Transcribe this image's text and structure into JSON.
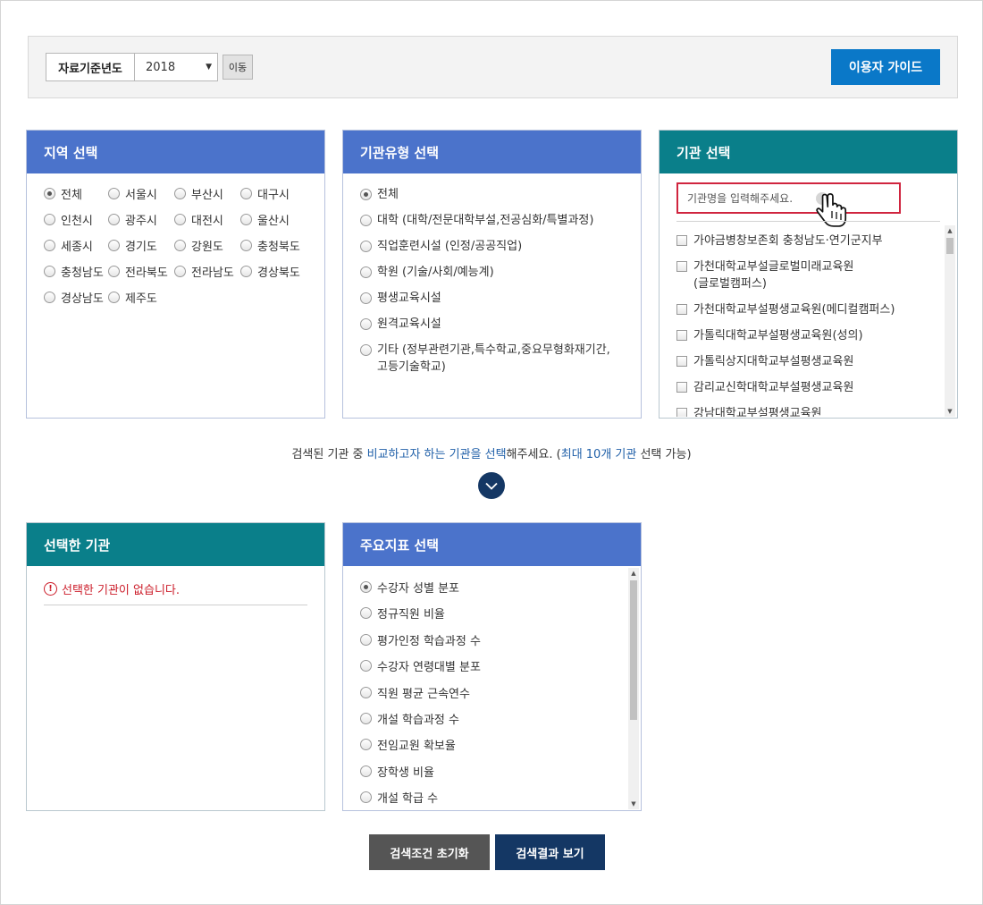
{
  "colors": {
    "panel_blue": "#4b73cb",
    "panel_teal": "#0a7f8a",
    "guide_button": "#0a78c8",
    "navy": "#143764",
    "error_red": "#cc1d2a",
    "highlight_text": "#1f5fa8"
  },
  "topbar": {
    "year_label": "자료기준년도",
    "year_value": "2018",
    "go_label": "이동",
    "guide_label": "이용자 가이드"
  },
  "region": {
    "title": "지역 선택",
    "selected": "전체",
    "options": [
      "전체",
      "서울시",
      "부산시",
      "대구시",
      "인천시",
      "광주시",
      "대전시",
      "울산시",
      "세종시",
      "경기도",
      "강원도",
      "충청북도",
      "충청남도",
      "전라북도",
      "전라남도",
      "경상북도",
      "경상남도",
      "제주도"
    ]
  },
  "type": {
    "title": "기관유형 선택",
    "selected": "전체",
    "options": [
      "전체",
      "대학 (대학/전문대학부설,전공심화/특별과정)",
      "직업훈련시설 (인정/공공직업)",
      "학원 (기술/사회/예능계)",
      "평생교육시설",
      "원격교육시설",
      "기타 (정부관련기관,특수학교,중요무형화재기간,\n고등기술학교)"
    ]
  },
  "institution": {
    "title": "기관 선택",
    "search_placeholder": "기관명을 입력해주세요.",
    "items": [
      "가야금병창보존회 충청남도·연기군지부",
      "가천대학교부설글로벌미래교육원\n(글로벌캠퍼스)",
      "가천대학교부설평생교육원(메디컬캠퍼스)",
      "가톨릭대학교부설평생교육원(성의)",
      "가톨릭상지대학교부설평생교육원",
      "감리교신학대학교부설평생교육원",
      "강남대학교부설평생교육원"
    ]
  },
  "notice": {
    "part1": "검색된 기관 중 ",
    "highlight1": "비교하고자 하는 기관을 선택",
    "part2": "해주세요. (",
    "highlight2": "최대 10개 기관",
    "part3": " 선택 가능)"
  },
  "selected_panel": {
    "title": "선택한 기관",
    "empty_message": "선택한 기관이 없습니다."
  },
  "indicator": {
    "title": "주요지표 선택",
    "selected": "수강자 성별 분포",
    "options": [
      "수강자 성별 분포",
      "정규직원 비율",
      "평가인정 학습과정 수",
      "수강자 연령대별 분포",
      "직원 평균 근속연수",
      "개설 학습과정 수",
      "전임교원 확보율",
      "장학생 비율",
      "개설 학급 수"
    ]
  },
  "buttons": {
    "reset": "검색조건 초기화",
    "result": "검색결과 보기"
  }
}
